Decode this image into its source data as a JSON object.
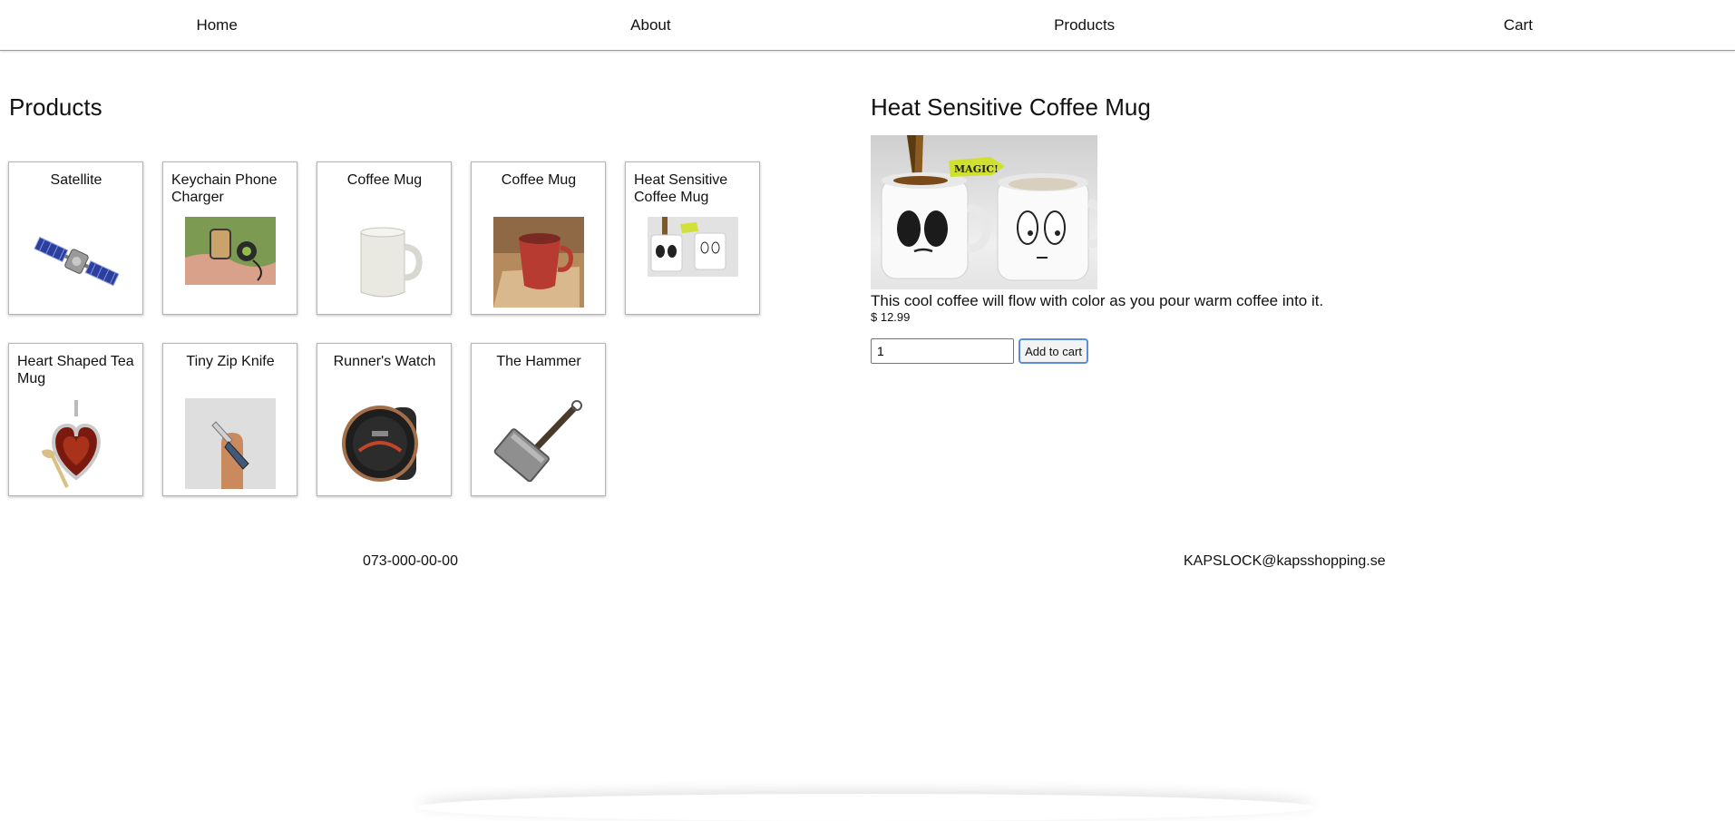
{
  "nav": {
    "items": [
      {
        "label": "Home"
      },
      {
        "label": "About"
      },
      {
        "label": "Products"
      },
      {
        "label": "Cart"
      }
    ]
  },
  "products": {
    "title": "Products",
    "items": [
      {
        "name": "Satellite",
        "icon": "satellite-image"
      },
      {
        "name": "Keychain Phone Charger",
        "icon": "keychain-charger-image"
      },
      {
        "name": "Coffee Mug",
        "icon": "white-mug-image"
      },
      {
        "name": "Coffee Mug",
        "icon": "red-mug-image"
      },
      {
        "name": "Heat Sensitive Coffee Mug",
        "icon": "heat-mug-image"
      },
      {
        "name": "Heart Shaped Tea Mug",
        "icon": "heart-mug-image"
      },
      {
        "name": "Tiny Zip Knife",
        "icon": "zip-knife-image"
      },
      {
        "name": "Runner's Watch",
        "icon": "watch-image"
      },
      {
        "name": "The Hammer",
        "icon": "hammer-image"
      }
    ]
  },
  "detail": {
    "title": "Heat Sensitive Coffee Mug",
    "magic_label": "MAGIC!",
    "description": "This cool coffee will flow with color as you pour warm coffee into it.",
    "price": "$ 12.99",
    "quantity": "1",
    "add_button_label": "Add to cart"
  },
  "footer": {
    "phone": "073-000-00-00",
    "email": "KAPSLOCK@kapsshopping.se"
  }
}
